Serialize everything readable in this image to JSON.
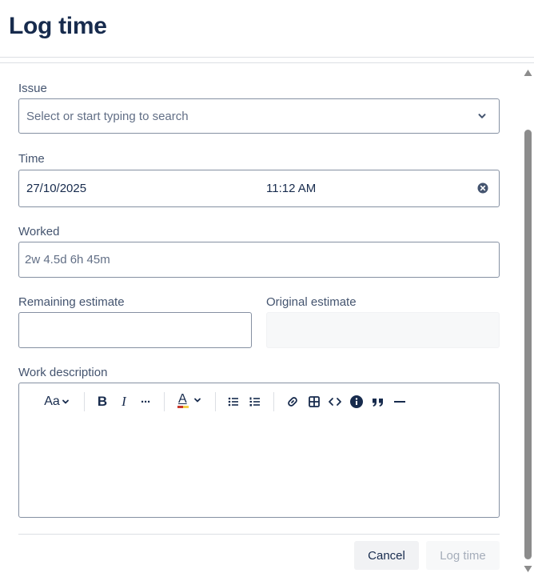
{
  "dialog": {
    "title": "Log time"
  },
  "issue": {
    "label": "Issue",
    "placeholder": "Select or start typing to search"
  },
  "time": {
    "label": "Time",
    "date": "27/10/2025",
    "clock": "11:12 AM"
  },
  "worked": {
    "label": "Worked",
    "placeholder": "2w 4.5d 6h 45m"
  },
  "remaining": {
    "label": "Remaining estimate",
    "value": ""
  },
  "original": {
    "label": "Original estimate",
    "value": ""
  },
  "description": {
    "label": "Work description",
    "toolbar": {
      "text_style": "Aa",
      "bold": "B",
      "italic": "I",
      "more": "···",
      "text_color": "A"
    }
  },
  "footer": {
    "cancel": "Cancel",
    "submit": "Log time"
  },
  "colors": {
    "primary_text": "#172b4d",
    "label_text": "#44546f",
    "border": "#8590a2",
    "disabled_text": "#a5adba"
  }
}
